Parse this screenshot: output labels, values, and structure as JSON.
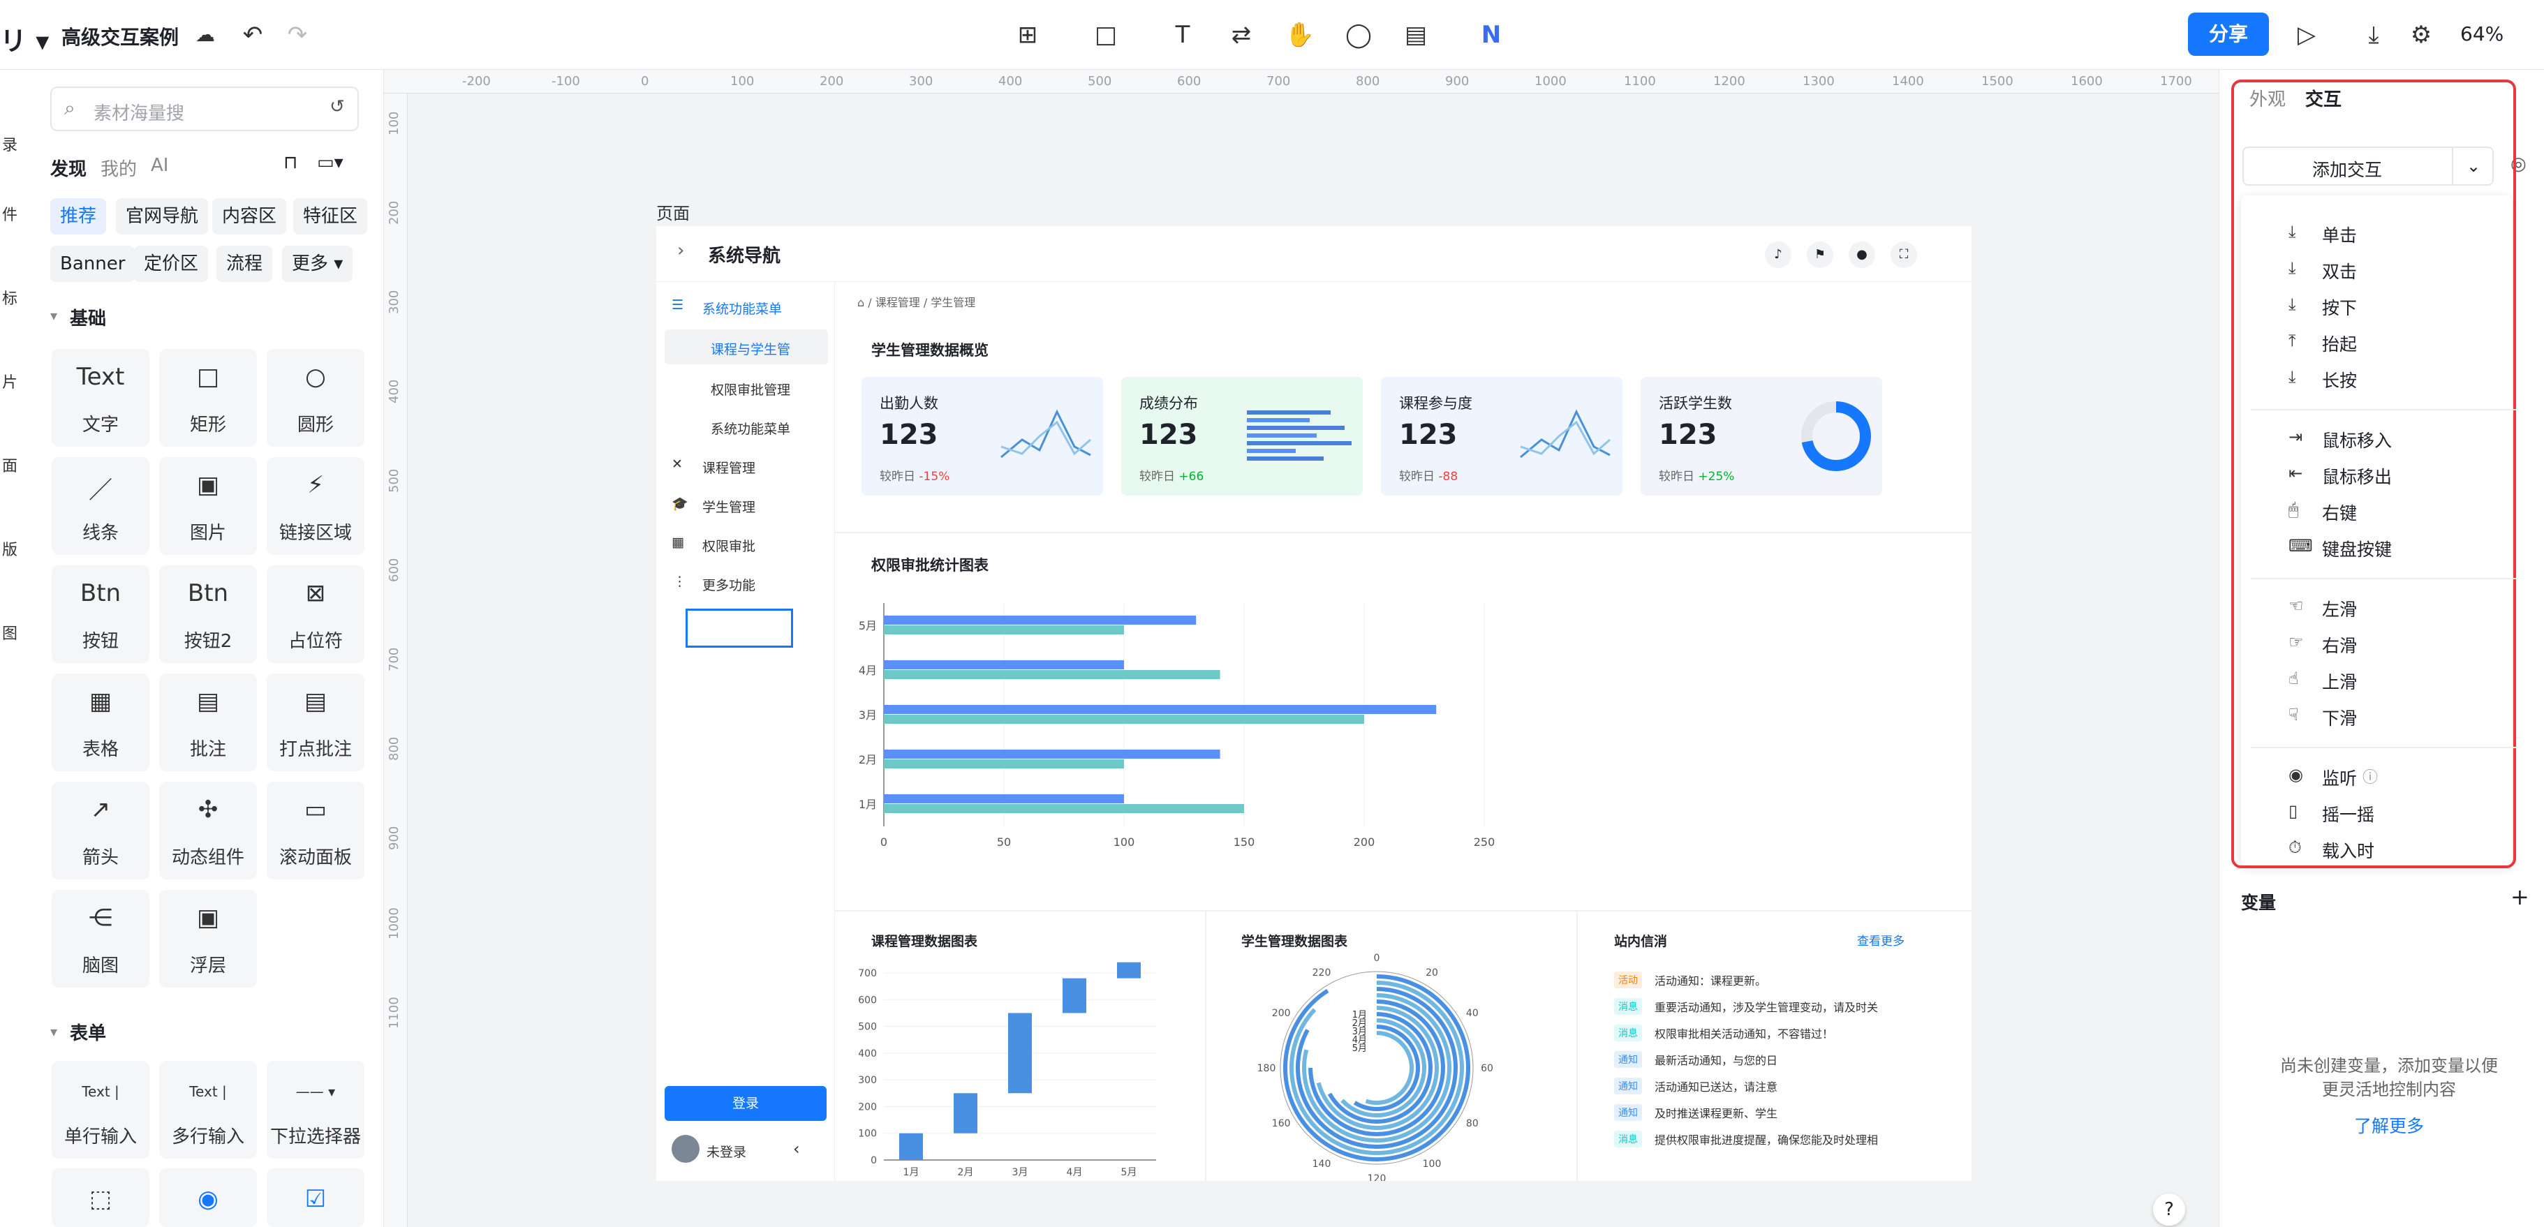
{
  "app": {
    "title": "高级交互案例",
    "share_label": "分享",
    "zoom": "64%"
  },
  "rail": [
    "录",
    "件",
    "标",
    "片",
    "面",
    "版",
    "图"
  ],
  "left_panel": {
    "search_placeholder": "素材海量搜",
    "tabs": [
      "发现",
      "我的",
      "AI"
    ],
    "chips": [
      "推荐",
      "官网导航",
      "内容区",
      "特征区",
      "Banner",
      "定价区",
      "流程",
      "更多"
    ],
    "section_basic": "基础",
    "components": [
      {
        "label": "文字",
        "icon": "Text"
      },
      {
        "label": "矩形",
        "icon": "□"
      },
      {
        "label": "圆形",
        "icon": "○"
      },
      {
        "label": "线条",
        "icon": "／"
      },
      {
        "label": "图片",
        "icon": "▣"
      },
      {
        "label": "链接区域",
        "icon": "⚡"
      },
      {
        "label": "按钮",
        "icon": "Btn"
      },
      {
        "label": "按钮2",
        "icon": "Btn"
      },
      {
        "label": "占位符",
        "icon": "⊠"
      },
      {
        "label": "表格",
        "icon": "▦"
      },
      {
        "label": "批注",
        "icon": "▤"
      },
      {
        "label": "打点批注",
        "icon": "▤"
      },
      {
        "label": "箭头",
        "icon": "↗"
      },
      {
        "label": "动态组件",
        "icon": "✣"
      },
      {
        "label": "滚动面板",
        "icon": "▭"
      },
      {
        "label": "脑图",
        "icon": "⋲"
      },
      {
        "label": "浮层",
        "icon": "▣"
      }
    ],
    "section_form": "表单",
    "form_components": [
      {
        "label": "单行输入",
        "icon": "Text |"
      },
      {
        "label": "多行输入",
        "icon": "Text |"
      },
      {
        "label": "下拉选择器",
        "icon": "—— ▾"
      }
    ]
  },
  "ruler_h": [
    "-200",
    "-100",
    "0",
    "100",
    "200",
    "300",
    "400",
    "500",
    "600",
    "700",
    "800",
    "900",
    "1000",
    "1100",
    "1200",
    "1300",
    "1400",
    "1500",
    "1600",
    "1700"
  ],
  "ruler_v": [
    "100",
    "200",
    "300",
    "400",
    "500",
    "600",
    "700",
    "800",
    "900",
    "1000",
    "1100"
  ],
  "page": {
    "label": "页面",
    "header_title": "系统导航",
    "nav": {
      "menu_title": "系统功能菜单",
      "sub_active": "课程与学生管",
      "sub_items": [
        "权限审批管理",
        "系统功能菜单"
      ],
      "items": [
        "课程管理",
        "学生管理",
        "权限审批",
        "更多功能"
      ],
      "login_button": "登录",
      "user_status": "未登录"
    },
    "breadcrumb": [
      "课程管理",
      "学生管理"
    ],
    "overview_title": "学生管理数据概览",
    "kpis": [
      {
        "title": "出勤人数",
        "value": "123",
        "compare": "较昨日",
        "delta": "-15%",
        "delta_color": "#f53f3f",
        "bg": "#eef5ff"
      },
      {
        "title": "成绩分布",
        "value": "123",
        "compare": "较昨日",
        "delta": "+66",
        "delta_color": "#00b42a",
        "bg": "#e8faf0"
      },
      {
        "title": "课程参与度",
        "value": "123",
        "compare": "较昨日",
        "delta": "-88",
        "delta_color": "#f53f3f",
        "bg": "#eef5ff"
      },
      {
        "title": "活跃学生数",
        "value": "123",
        "compare": "较昨日",
        "delta": "+25%",
        "delta_color": "#00b42a",
        "bg": "#f2f4fb"
      }
    ],
    "bar_chart_title": "权限审批统计图表",
    "course_chart_title": "课程管理数据图表",
    "student_chart_title": "学生管理数据图表",
    "messages": {
      "title": "站内信消",
      "more": "查看更多",
      "items": [
        {
          "tag": "活动",
          "text": "活动通知：课程更新。",
          "color": "#ff7d00"
        },
        {
          "tag": "消息",
          "text": "重要活动通知，涉及学生管理变动，请及时关",
          "color": "#14c9c9"
        },
        {
          "tag": "消息",
          "text": "权限审批相关活动通知，不容错过！",
          "color": "#14c9c9"
        },
        {
          "tag": "通知",
          "text": "最新活动通知，与您的日",
          "color": "#3491fa"
        },
        {
          "tag": "通知",
          "text": "活动通知已送达，请注意",
          "color": "#3491fa"
        },
        {
          "tag": "通知",
          "text": "及时推送课程更新、学生",
          "color": "#3491fa"
        },
        {
          "tag": "消息",
          "text": "提供权限审批进度提醒，确保您能及时处理相",
          "color": "#14c9c9"
        }
      ]
    }
  },
  "chart_data": [
    {
      "type": "bar",
      "orientation": "horizontal",
      "title": "权限审批统计图表",
      "categories": [
        "1月",
        "2月",
        "3月",
        "4月",
        "5月"
      ],
      "series": [
        {
          "values": [
            100,
            140,
            230,
            100,
            130
          ],
          "color": "#5b8ff9"
        },
        {
          "values": [
            150,
            100,
            200,
            140,
            100
          ],
          "color": "#6dc8c8"
        }
      ],
      "xlim": [
        0,
        250
      ],
      "xticks": [
        "0",
        "50",
        "100",
        "150",
        "200",
        "250"
      ]
    },
    {
      "type": "bar",
      "subtype": "waterfall",
      "title": "课程管理数据图表",
      "categories": [
        "1月",
        "2月",
        "3月",
        "4月",
        "5月"
      ],
      "values": [
        [
          0,
          100
        ],
        [
          100,
          250
        ],
        [
          250,
          550
        ],
        [
          550,
          680
        ],
        [
          680,
          870
        ]
      ],
      "ylim": [
        0,
        700
      ],
      "yticks": [
        "0",
        "100",
        "200",
        "300",
        "400",
        "500",
        "600",
        "700"
      ]
    },
    {
      "type": "bar",
      "subtype": "radial",
      "title": "学生管理数据图表",
      "categories": [
        "1月",
        "2月",
        "3月",
        "4月",
        "5月"
      ],
      "ticks": [
        "0",
        "20",
        "40",
        "60",
        "80",
        "100",
        "120",
        "140",
        "160",
        "180",
        "200",
        "220"
      ]
    }
  ],
  "right_panel": {
    "tabs": [
      "外观",
      "交互"
    ],
    "add_interaction": "添加交互",
    "groups": [
      [
        "单击",
        "双击",
        "按下",
        "抬起",
        "长按"
      ],
      [
        "鼠标移入",
        "鼠标移出",
        "右键",
        "键盘按键"
      ],
      [
        "左滑",
        "右滑",
        "上滑",
        "下滑"
      ],
      [
        "监听",
        "摇一摇",
        "载入时"
      ]
    ],
    "variables_title": "变量",
    "empty_text_1": "尚未创建变量，添加变量以便",
    "empty_text_2": "更灵活地控制内容",
    "learn_more": "了解更多"
  }
}
